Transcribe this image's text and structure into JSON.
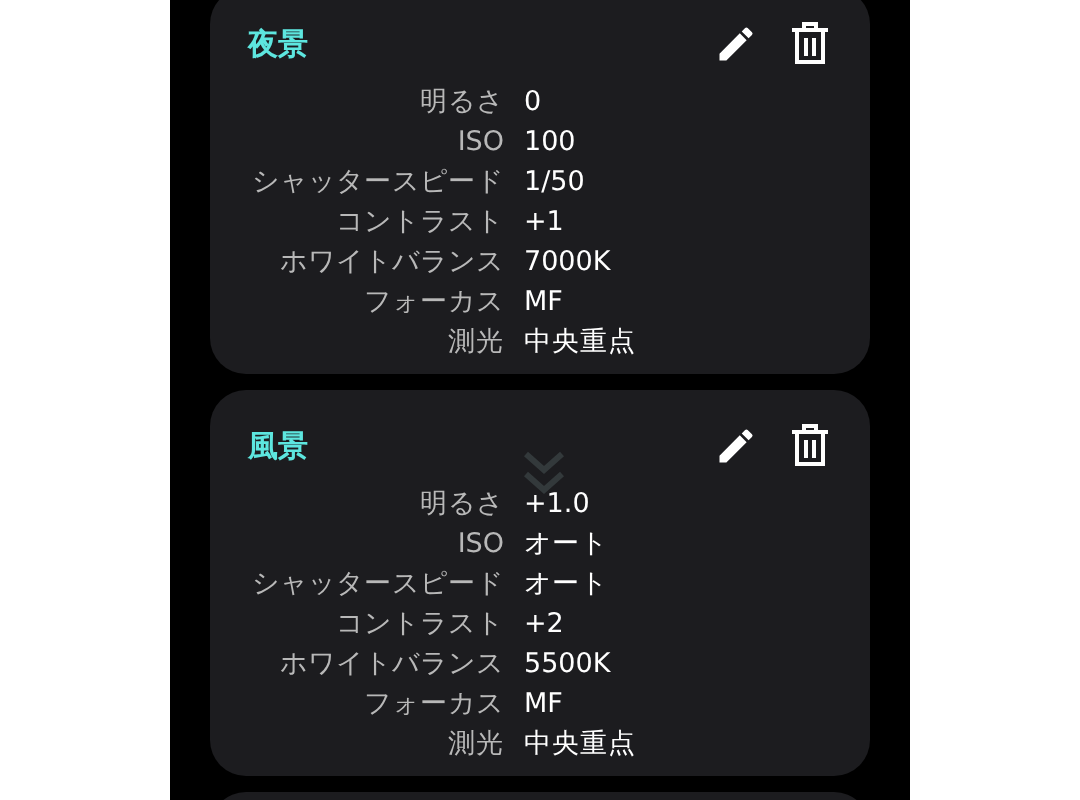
{
  "presets": [
    {
      "name": "夜景",
      "settings": [
        {
          "label": "明るさ",
          "value": "0"
        },
        {
          "label": "ISO",
          "value": "100"
        },
        {
          "label": "シャッタースピード",
          "value": "1/50"
        },
        {
          "label": "コントラスト",
          "value": "+1"
        },
        {
          "label": "ホワイトバランス",
          "value": "7000K"
        },
        {
          "label": "フォーカス",
          "value": "MF"
        },
        {
          "label": "測光",
          "value": "中央重点"
        }
      ]
    },
    {
      "name": "風景",
      "settings": [
        {
          "label": "明るさ",
          "value": "+1.0"
        },
        {
          "label": "ISO",
          "value": "オート"
        },
        {
          "label": "シャッタースピード",
          "value": "オート"
        },
        {
          "label": "コントラスト",
          "value": "+2"
        },
        {
          "label": "ホワイトバランス",
          "value": "5500K"
        },
        {
          "label": "フォーカス",
          "value": "MF"
        },
        {
          "label": "測光",
          "value": "中央重点"
        }
      ]
    }
  ]
}
